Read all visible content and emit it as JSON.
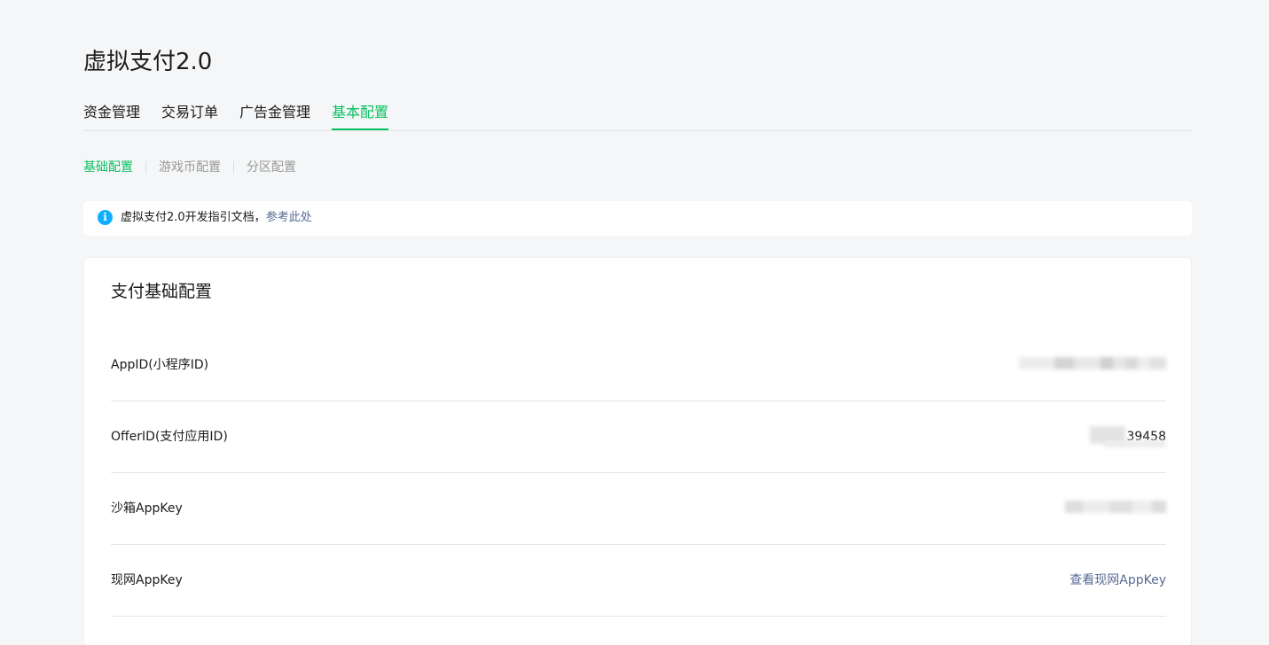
{
  "header": {
    "title": "虚拟支付2.0"
  },
  "tabs": [
    {
      "label": "资金管理",
      "active": false
    },
    {
      "label": "交易订单",
      "active": false
    },
    {
      "label": "广告金管理",
      "active": false
    },
    {
      "label": "基本配置",
      "active": true
    }
  ],
  "subtabs": [
    {
      "label": "基础配置",
      "active": true
    },
    {
      "label": "游戏币配置",
      "active": false
    },
    {
      "label": "分区配置",
      "active": false
    }
  ],
  "notice": {
    "icon": "info-icon",
    "text": "虚拟支付2.0开发指引文档，",
    "link": "参考此处"
  },
  "card": {
    "title": "支付基础配置",
    "rows": [
      {
        "label": "AppID(小程序ID)",
        "value": "",
        "obscured": true
      },
      {
        "label": "OfferID(支付应用ID)",
        "value": "39458",
        "obscured": true
      },
      {
        "label": "沙箱AppKey",
        "value": "",
        "obscured": true
      },
      {
        "label": "现网AppKey",
        "value": "查看现网AppKey",
        "obscured": false
      }
    ]
  },
  "colors": {
    "accent": "#07c160",
    "link": "#576b95",
    "info": "#10aeff",
    "background": "#f5f6f7"
  }
}
